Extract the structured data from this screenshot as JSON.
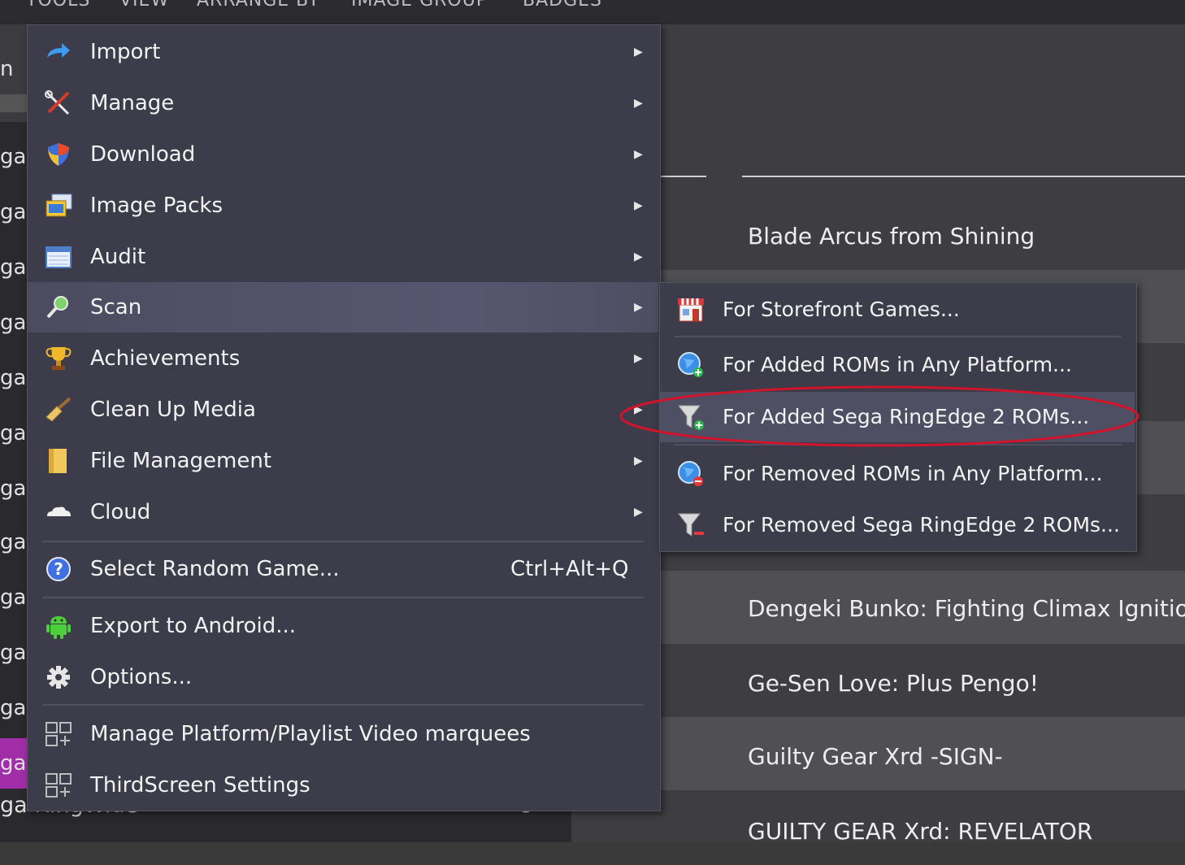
{
  "menubar": {
    "items": [
      "TOOLS",
      "VIEW",
      "ARRANGE BY",
      "IMAGE GROUP",
      "BADGES"
    ]
  },
  "sidebar": {
    "top_fragment": "n",
    "fragments": [
      "ga",
      "ga",
      "ga",
      "ga",
      "ga",
      "ga",
      "ga",
      "ga",
      "ga",
      "ga",
      "ga",
      "ga"
    ],
    "selected_fragment": "ga",
    "bottom_label": "ga RingWide",
    "bottom_count": "9"
  },
  "games": [
    "Blade Arcus from Shining",
    "Dengeki Bunko: Fighting Climax Ignition",
    "Ge-Sen Love: Plus Pengo!",
    "Guilty Gear Xrd -SIGN-",
    "GUILTY GEAR Xrd: REVELATOR"
  ],
  "menu": {
    "items": [
      {
        "label": "Import",
        "icon": "import-arrow-icon"
      },
      {
        "label": "Manage",
        "icon": "tools-icon"
      },
      {
        "label": "Download",
        "icon": "download-shield-icon"
      },
      {
        "label": "Image Packs",
        "icon": "image-packs-icon"
      },
      {
        "label": "Audit",
        "icon": "audit-calendar-icon"
      },
      {
        "label": "Scan",
        "icon": "scan-magnifier-icon"
      },
      {
        "label": "Achievements",
        "icon": "trophy-icon"
      },
      {
        "label": "Clean Up Media",
        "icon": "broom-icon"
      },
      {
        "label": "File Management",
        "icon": "folder-icon"
      },
      {
        "label": "Cloud",
        "icon": "cloud-icon"
      },
      {
        "label": "Select Random Game...",
        "icon": "help-question-icon",
        "shortcut": "Ctrl+Alt+Q"
      },
      {
        "label": "Export to Android...",
        "icon": "android-icon"
      },
      {
        "label": "Options...",
        "icon": "gear-icon"
      },
      {
        "label": "Manage Platform/Playlist Video marquees",
        "icon": "plugin-grid-icon"
      },
      {
        "label": "ThirdScreen Settings",
        "icon": "plugin-grid-icon"
      }
    ]
  },
  "scan_submenu": {
    "items": [
      {
        "label": "For Storefront Games...",
        "icon": "storefront-icon"
      },
      {
        "label": "For Added ROMs in Any Platform...",
        "icon": "globe-add-icon"
      },
      {
        "label": "For Added Sega RingEdge 2 ROMs...",
        "icon": "filter-add-icon"
      },
      {
        "label": "For Removed ROMs in Any Platform...",
        "icon": "globe-remove-icon"
      },
      {
        "label": "For Removed Sega RingEdge 2 ROMs...",
        "icon": "filter-remove-icon"
      }
    ]
  },
  "colors": {
    "menu_bg": "#3c3c4a",
    "highlight": "#565670",
    "selection_purple": "#a12ea8",
    "annotation_red": "#d0142c"
  }
}
